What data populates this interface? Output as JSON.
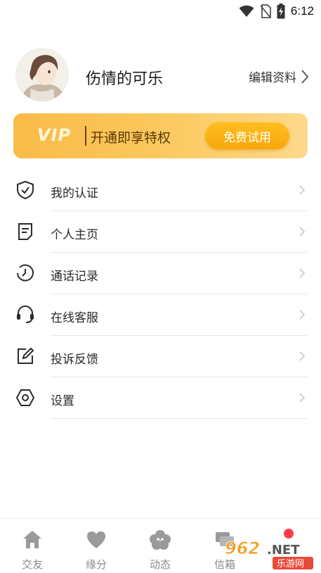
{
  "status_bar": {
    "time": "6:12",
    "icons": [
      "wifi-icon",
      "no-sim-icon",
      "battery-charging-icon"
    ]
  },
  "profile": {
    "username": "伤情的可乐",
    "edit_label": "编辑资料"
  },
  "vip_banner": {
    "logo": "VIP",
    "text": "开通即享特权",
    "button_label": "免费试用"
  },
  "menu": {
    "items": [
      {
        "label": "我的认证",
        "icon": "shield-check-icon"
      },
      {
        "label": "个人主页",
        "icon": "document-icon"
      },
      {
        "label": "通话记录",
        "icon": "clock-icon"
      },
      {
        "label": "在线客服",
        "icon": "headset-icon"
      },
      {
        "label": "投诉反馈",
        "icon": "edit-icon"
      },
      {
        "label": "设置",
        "icon": "settings-gear-icon"
      }
    ]
  },
  "bottom_nav": {
    "items": [
      {
        "label": "交友",
        "icon": "home-icon"
      },
      {
        "label": "缘分",
        "icon": "heart-icon"
      },
      {
        "label": "动态",
        "icon": "flower-icon"
      },
      {
        "label": "信箱",
        "icon": "chat-bubbles-icon"
      }
    ]
  },
  "watermark": {
    "text_top": "962.NET",
    "text_bottom": "乐游网"
  },
  "colors": {
    "vip_gradient_start": "#f9bb49",
    "vip_gradient_end": "#fdd98a",
    "vip_button": "#f7a70c",
    "badge": "#ff3b4a",
    "nav_icon": "#9a9a9a"
  }
}
